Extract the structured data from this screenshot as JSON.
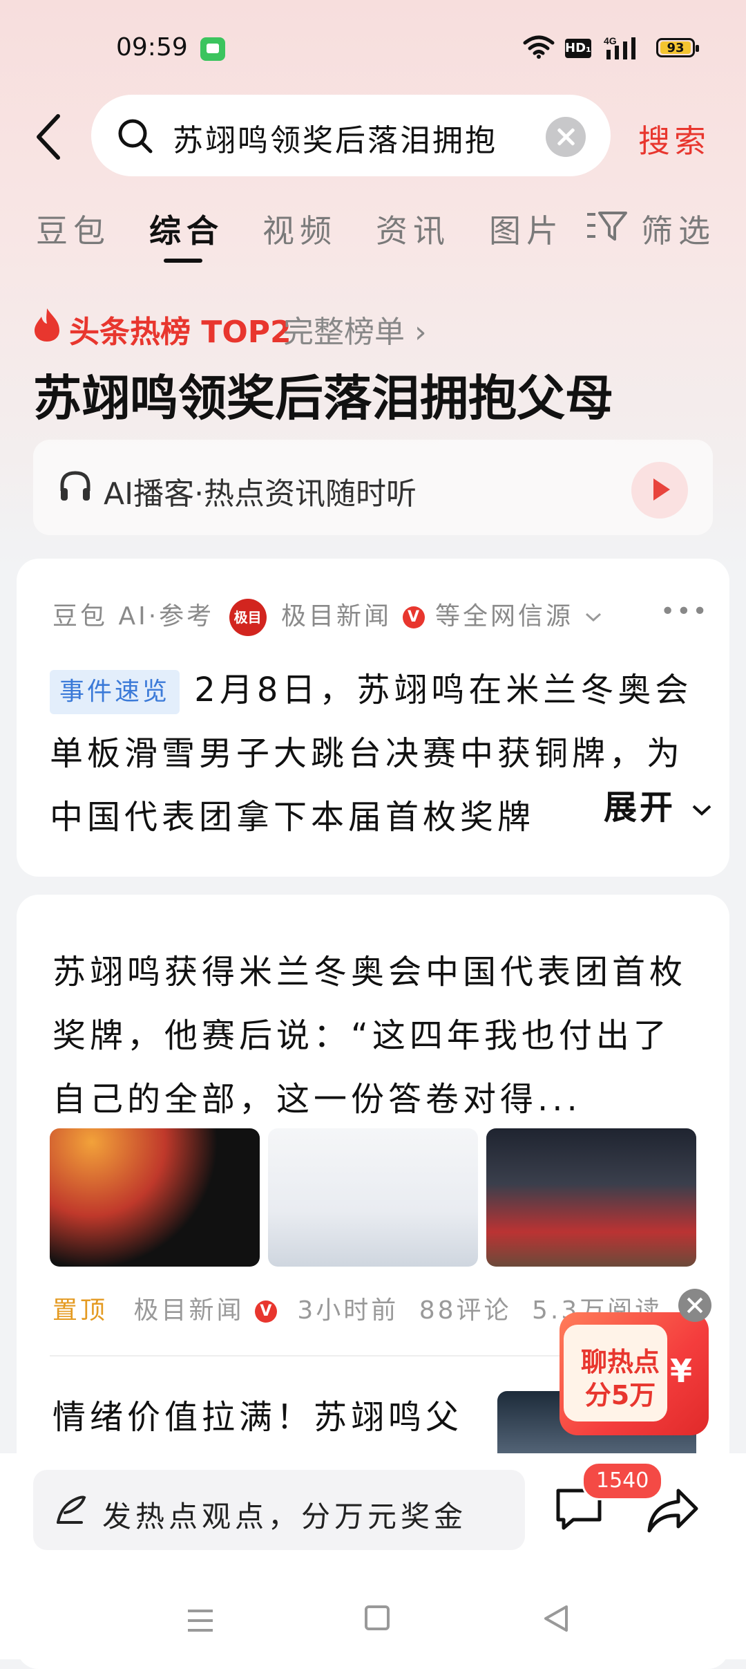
{
  "status_bar": {
    "time": "09:59",
    "network_badge": "HD₁",
    "signal_label": "4G",
    "battery": "93"
  },
  "search": {
    "query": "苏翊鸣领奖后落泪拥抱",
    "button_label": "搜索"
  },
  "tabs": [
    {
      "label": "豆包"
    },
    {
      "label": "综合",
      "active": true
    },
    {
      "label": "视频"
    },
    {
      "label": "资讯"
    },
    {
      "label": "图片"
    },
    {
      "label": "筛选"
    }
  ],
  "hot": {
    "label": "头条热榜 TOP2",
    "full_list": "完整榜单 ›"
  },
  "headline": "苏翊鸣领奖后落泪拥抱父母",
  "podcast": {
    "text": "AI播客·热点资讯随时听"
  },
  "ai_card": {
    "source_prefix": "豆包 AI·参考",
    "logo_text": "极目",
    "source_name": "极目新闻",
    "source_suffix": "等全网信源",
    "tag": "事件速览",
    "summary": "2月8日，苏翊鸣在米兰冬奥会单板滑雪男子大跳台决赛中获铜牌，为中国代表团拿下本届首枚奖牌",
    "expand": "展开"
  },
  "news1": {
    "title": "苏翊鸣获得米兰冬奥会中国代表团首枚奖牌，他赛后说：“这四年我也付出了自己的全部，这一份答卷对得...",
    "pin": "置顶",
    "source": "极目新闻",
    "time": "3小时前",
    "comments": "88评论",
    "reads": "5.3万阅读"
  },
  "news2": {
    "title": "情绪价值拉满！苏翊鸣父"
  },
  "promo": {
    "line1": "聊热点",
    "line2": "分5万",
    "symbol": "¥"
  },
  "bottom": {
    "placeholder": "发热点观点，分万元奖金",
    "comment_count": "1540"
  },
  "colors": {
    "accent": "#e8362e",
    "pin": "#e49a21",
    "tag_blue": "#3b7ad8"
  }
}
